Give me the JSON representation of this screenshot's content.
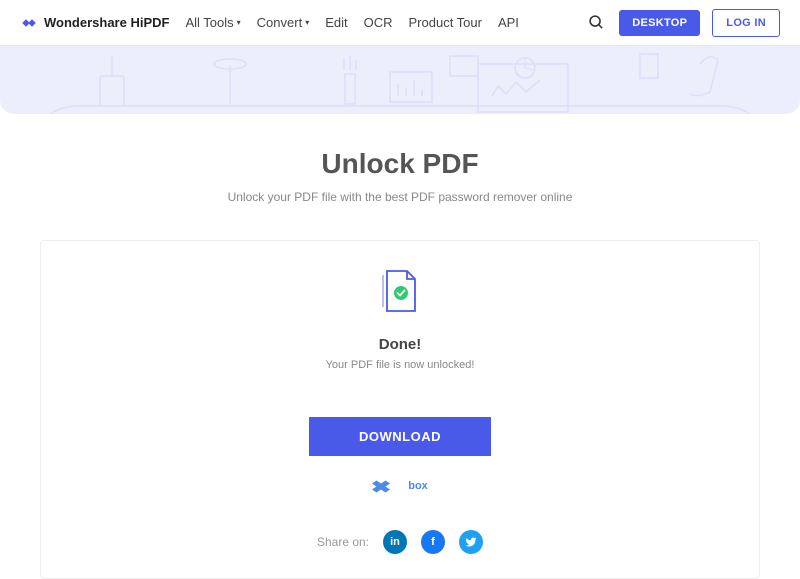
{
  "brand": "Wondershare HiPDF",
  "nav": {
    "all_tools": "All Tools",
    "convert": "Convert",
    "edit": "Edit",
    "ocr": "OCR",
    "product_tour": "Product Tour",
    "api": "API"
  },
  "buttons": {
    "desktop": "DESKTOP",
    "login": "LOG IN",
    "download": "DOWNLOAD"
  },
  "page": {
    "title": "Unlock PDF",
    "subtitle": "Unlock your PDF file with the best PDF password remover online"
  },
  "status": {
    "title": "Done!",
    "message": "Your PDF file is now unlocked!"
  },
  "cloud": {
    "box": "box"
  },
  "share": {
    "label": "Share on:"
  }
}
